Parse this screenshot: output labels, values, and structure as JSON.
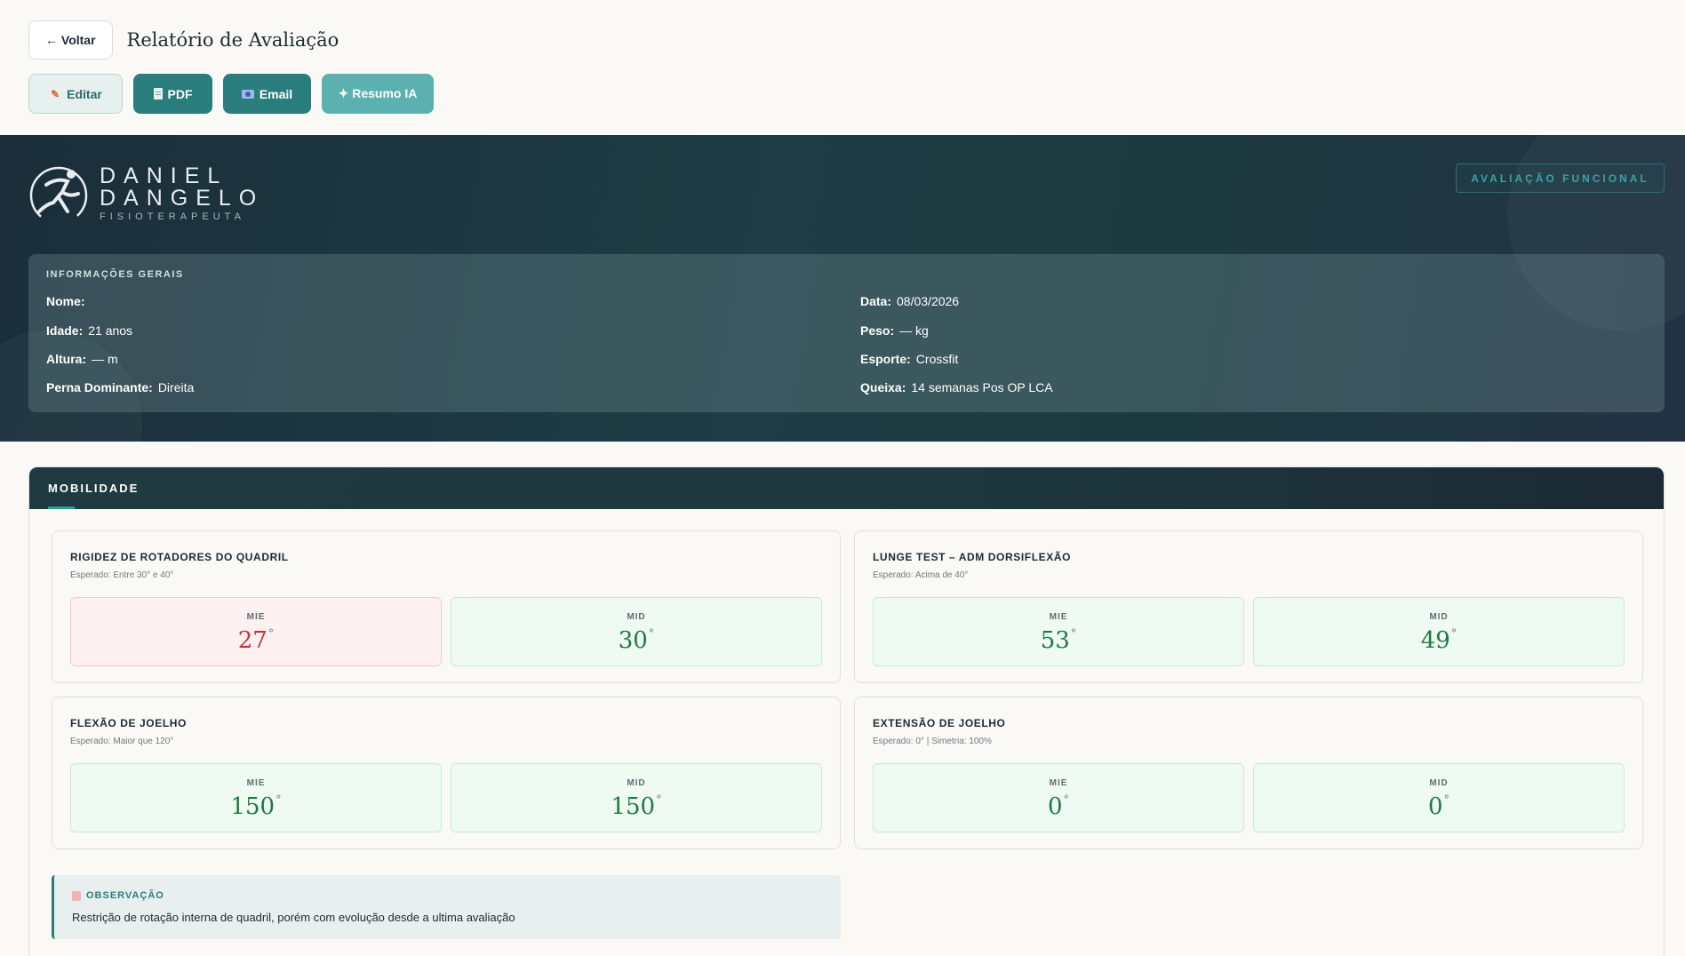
{
  "header": {
    "back_label": "← Voltar",
    "title": "Relatório de Avaliação"
  },
  "actions": {
    "edit": "Editar",
    "pdf": "PDF",
    "email": "Email",
    "ai_summary": "✦ Resumo IA"
  },
  "brand": {
    "name_line1": "DANIEL",
    "name_line2": "DANGELO",
    "subtitle": "FISIOTERAPEUTA",
    "tag": "AVALIAÇÃO FUNCIONAL"
  },
  "info": {
    "title": "INFORMAÇÕES GERAIS",
    "left": [
      {
        "label": "Nome:",
        "value": ""
      },
      {
        "label": "Idade:",
        "value": "21 anos"
      },
      {
        "label": "Altura:",
        "value": "— m"
      },
      {
        "label": "Perna Dominante:",
        "value": "Direita"
      }
    ],
    "right": [
      {
        "label": "Data:",
        "value": "08/03/2026"
      },
      {
        "label": "Peso:",
        "value": "— kg"
      },
      {
        "label": "Esporte:",
        "value": "Crossfit"
      },
      {
        "label": "Queixa:",
        "value": "14 semanas Pos OP LCA"
      }
    ]
  },
  "mobility": {
    "title": "MOBILIDADE",
    "cards": [
      {
        "title": "RIGIDEZ DE ROTADORES DO QUADRIL",
        "expected": "Esperado: Entre 30° e 40°",
        "left": {
          "label": "MIE",
          "value": "27",
          "unit": "°",
          "status": "bad"
        },
        "right": {
          "label": "MID",
          "value": "30",
          "unit": "°",
          "status": "ok"
        }
      },
      {
        "title": "LUNGE TEST – ADM DORSIFLEXÃO",
        "expected": "Esperado: Acima de 40°",
        "left": {
          "label": "MIE",
          "value": "53",
          "unit": "°",
          "status": "ok"
        },
        "right": {
          "label": "MID",
          "value": "49",
          "unit": "°",
          "status": "ok"
        }
      },
      {
        "title": "FLEXÃO DE JOELHO",
        "expected": "Esperado: Maior que 120°",
        "left": {
          "label": "MIE",
          "value": "150",
          "unit": "°",
          "status": "ok"
        },
        "right": {
          "label": "MID",
          "value": "150",
          "unit": "°",
          "status": "ok"
        }
      },
      {
        "title": "EXTENSÃO DE JOELHO",
        "expected": "Esperado: 0° | Simetria: 100%",
        "left": {
          "label": "MIE",
          "value": "0",
          "unit": "°",
          "status": "ok"
        },
        "right": {
          "label": "MID",
          "value": "0",
          "unit": "°",
          "status": "ok"
        }
      }
    ],
    "observation": {
      "title": "OBSERVAÇÃO",
      "text": "Restrição de rotação interna de quadril, porém com evolução desde a ultima avaliação"
    }
  }
}
